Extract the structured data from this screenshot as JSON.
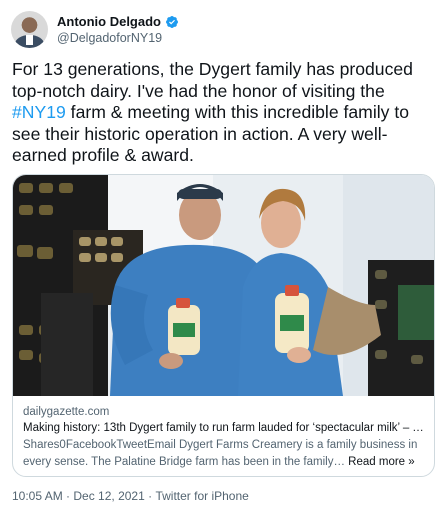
{
  "author": {
    "display_name": "Antonio Delgado",
    "handle": "@DelgadoforNY19",
    "verified": true,
    "avatar_icon": "profile-photo"
  },
  "tweet": {
    "text_before": "For 13 generations, the Dygert family has produced top-notch dairy. I've had the honor of visiting the ",
    "hashtag": "#NY19",
    "text_after": " farm & meeting with this incredible family to see their historic operation in action. A very well-earned profile & award."
  },
  "card": {
    "domain": "dailygazette.com",
    "title": "Making history: 13th Dygert family to run farm lauded for ‘spectacular milk’ – T…",
    "description": "Shares0FacebookTweetEmail Dygert Farms Creamery is a family business in every sense. The Palatine Bridge farm has been in the family…",
    "read_more": "Read more »"
  },
  "meta": {
    "time": "10:05 AM",
    "separator1": " · ",
    "date": "Dec 12, 2021",
    "separator2": " · ",
    "source": "Twitter for iPhone"
  },
  "colors": {
    "link_blue": "#1d9bf0",
    "text_primary": "#0f1419",
    "text_secondary": "#536471",
    "border": "#cfd9de"
  }
}
